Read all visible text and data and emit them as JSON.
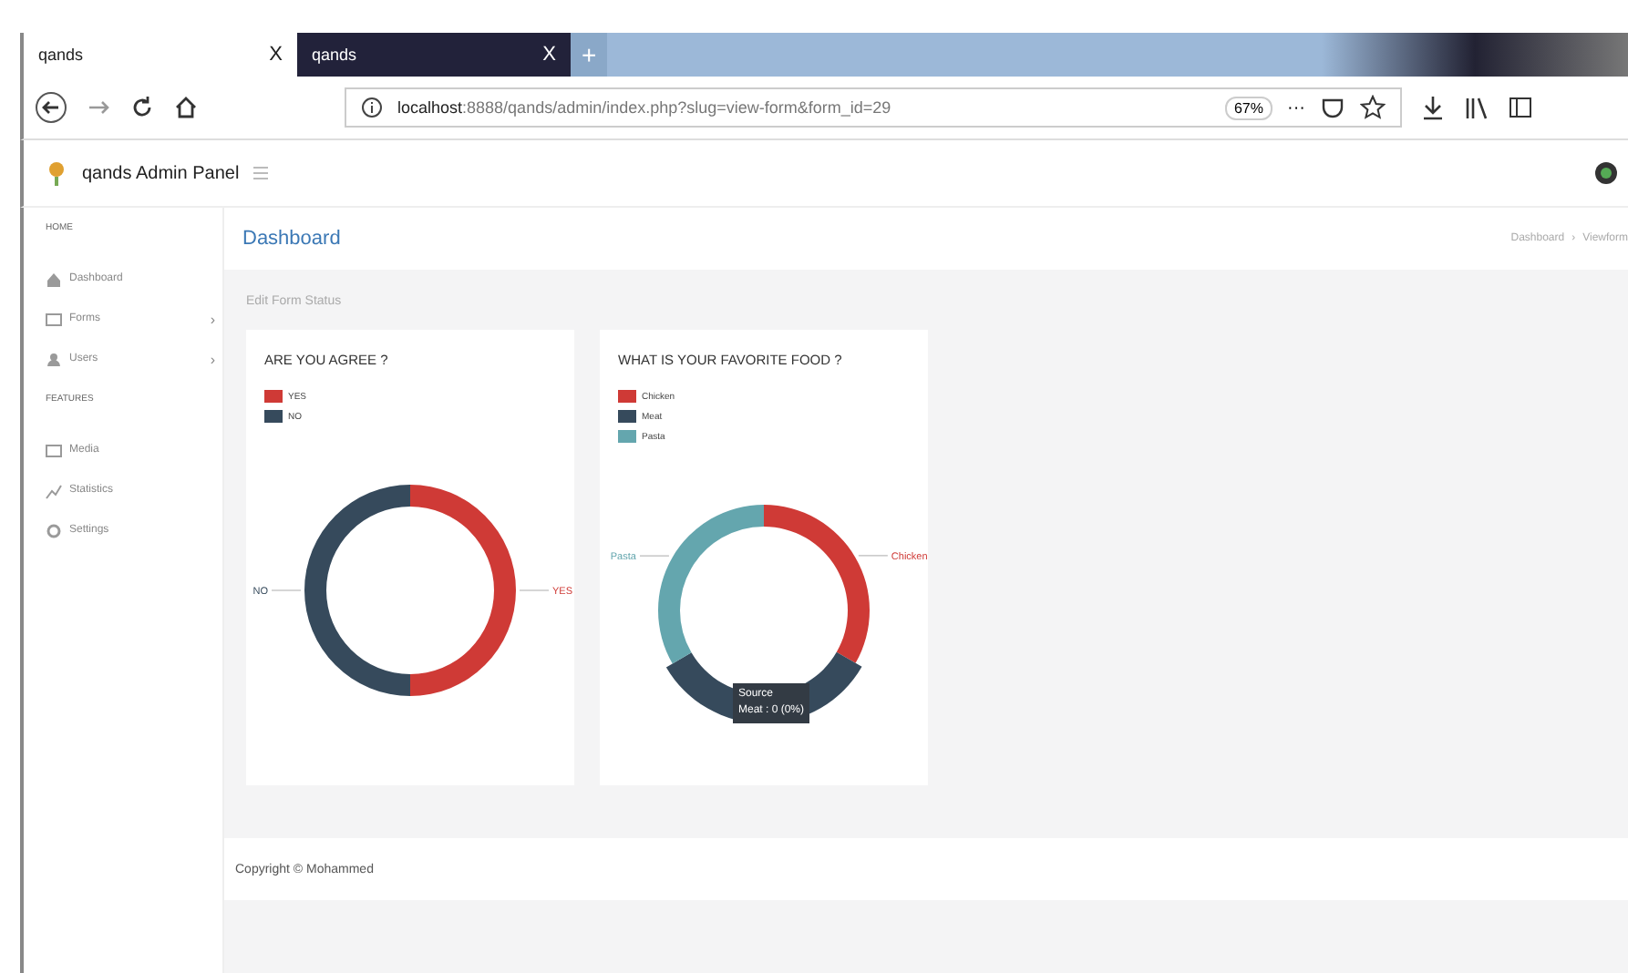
{
  "browser": {
    "tabs": [
      {
        "label": "qands",
        "selected": true,
        "close": "X"
      },
      {
        "label": "qands",
        "selected": false,
        "close": "X"
      }
    ],
    "new_tab": "+",
    "url": {
      "host": "localhost",
      "rest": ":8888/qands/admin/index.php?slug=view-form&form_id=29"
    },
    "zoom": "67%",
    "more": "···"
  },
  "app": {
    "brand": "qands Admin Panel"
  },
  "sidebar": {
    "sections": [
      {
        "heading": "HOME",
        "items": [
          {
            "label": "Dashboard"
          },
          {
            "label": "Forms",
            "arrow": "›"
          },
          {
            "label": "Users",
            "arrow": "›"
          }
        ]
      },
      {
        "heading": "FEATURES",
        "items": [
          {
            "label": "Media"
          },
          {
            "label": "Statistics"
          },
          {
            "label": "Settings"
          }
        ]
      }
    ]
  },
  "page": {
    "title": "Dashboard",
    "breadcrumb": [
      "Dashboard",
      "›",
      "Viewform"
    ],
    "subtitle": "Edit Form Status"
  },
  "cards": [
    {
      "chart_data": {
        "type": "donut",
        "title": "ARE YOU AGREE ?",
        "categories": [
          "YES",
          "NO"
        ],
        "colors": [
          "#cf3a36",
          "#364a5c"
        ],
        "series": [
          {
            "values": [
              50,
              50
            ]
          }
        ]
      },
      "highlighted": [
        false,
        false
      ]
    },
    {
      "chart_data": {
        "type": "donut",
        "title": "WHAT IS YOUR FAVORITE FOOD ?",
        "categories": [
          "Chicken",
          "Meat",
          "Pasta"
        ],
        "colors": [
          "#cf3a36",
          "#364a5c",
          "#64a6ae"
        ],
        "series": [
          {
            "values": [
              33.3,
              33.3,
              33.4
            ]
          }
        ]
      },
      "highlighted": [
        false,
        true,
        false
      ],
      "tooltip": {
        "title": "Source",
        "text": "Meat : 0 (0%)"
      }
    }
  ],
  "footer": "Copyright © Mohammed"
}
